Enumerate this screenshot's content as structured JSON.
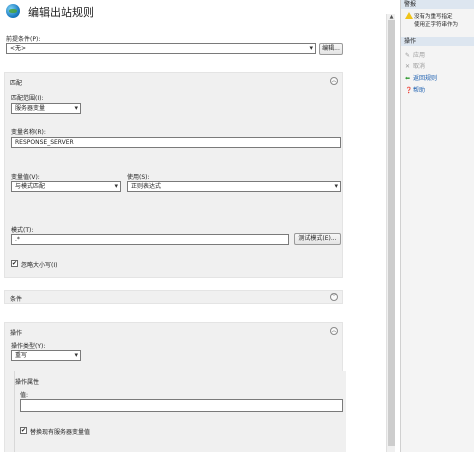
{
  "header": {
    "title": "编辑出站规则"
  },
  "precondition": {
    "label": "前提条件(P):",
    "value": "<无>",
    "edit_button": "编辑..."
  },
  "match": {
    "title": "匹配",
    "scope_label": "匹配范围(I):",
    "scope_value": "服务器变量",
    "var_name_label": "变量名称(R):",
    "var_name_value": "RESPONSE_SERVER",
    "var_value_label": "变量值(V):",
    "var_value_value": "与模式匹配",
    "using_label": "使用(S):",
    "using_value": "正则表达式",
    "pattern_label": "模式(T):",
    "pattern_value": ".*",
    "test_button": "测试模式(E)...",
    "ignore_case_label": "忽略大小写(I)",
    "ignore_case_checked": "✔"
  },
  "conditions": {
    "title": "条件"
  },
  "action": {
    "title": "操作",
    "type_label": "操作类型(Y):",
    "type_value": "重写",
    "props_title": "操作属性",
    "value_label": "值:",
    "value_value": "",
    "replace_label": "替换现有服务器变量值",
    "replace_checked": "✔"
  },
  "right_pane": {
    "alert_header": "警报",
    "alert_lines": [
      "没有为重写指定",
      "使用正字符串作为"
    ],
    "actions_header": "操作",
    "actions": [
      {
        "label": "应用",
        "enabled": false
      },
      {
        "label": "取消",
        "enabled": false
      },
      {
        "label": "返回规则",
        "enabled": true
      },
      {
        "label": "帮助",
        "enabled": true
      }
    ]
  },
  "colors": {
    "accent": "#1c5fb0",
    "group_bg": "#f0f0f0",
    "pane_header": "#dde6f0",
    "warning": "#f0c419"
  }
}
